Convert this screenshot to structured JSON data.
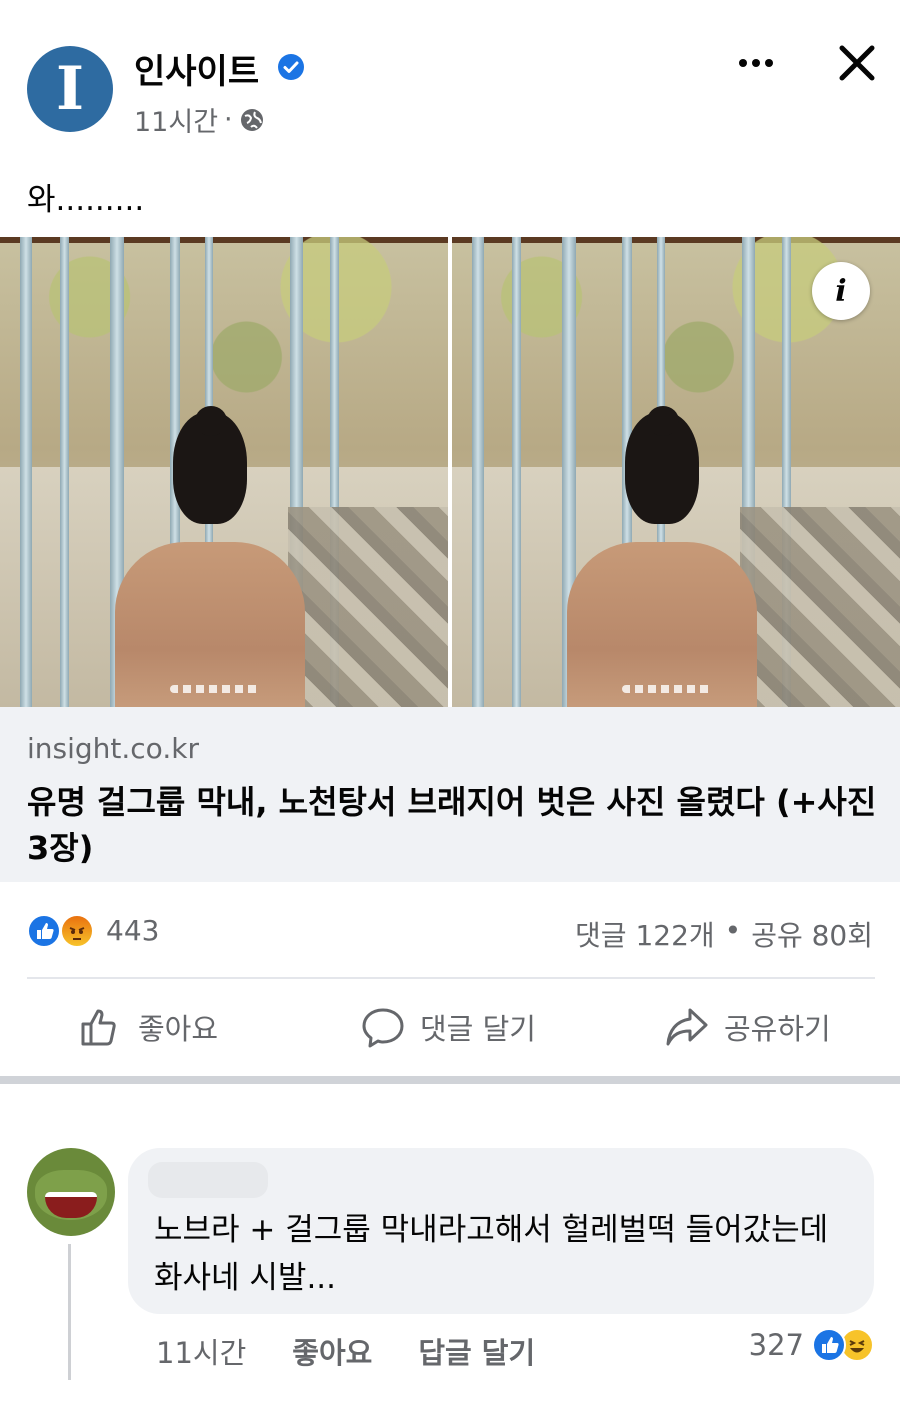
{
  "post": {
    "page_name": "인사이트",
    "logo_letter": "I",
    "time": "11시간",
    "separator": "·",
    "text": "와........."
  },
  "link_card": {
    "domain": "insight.co.kr",
    "title": "유명 걸그룹 막내, 노천탕서 브래지어 벗은 사진 올렸다 (+사진 3장)"
  },
  "stats": {
    "reaction_count": "443",
    "comments": "댓글 122개",
    "dot": "•",
    "shares": "공유 80회"
  },
  "actions": {
    "like": "좋아요",
    "comment": "댓글 달기",
    "share": "공유하기"
  },
  "comment": {
    "text": "노브라 + 걸그룹 막내라고해서 헐레벌떡 들어갔는데 화사네 시발...",
    "time": "11시간",
    "like": "좋아요",
    "reply": "답글 달기",
    "reaction_count": "327"
  },
  "colors": {
    "brand_blue": "#1b74e4",
    "logo_blue": "#2e6ba1",
    "muted_text": "#65676b",
    "card_bg": "#f0f2f5"
  },
  "icons": [
    "verified-badge-icon",
    "globe-icon",
    "more-icon",
    "close-icon",
    "info-icon",
    "like-reaction-icon",
    "angry-reaction-icon",
    "thumbs-up-icon",
    "comment-icon",
    "share-icon",
    "haha-reaction-icon"
  ]
}
